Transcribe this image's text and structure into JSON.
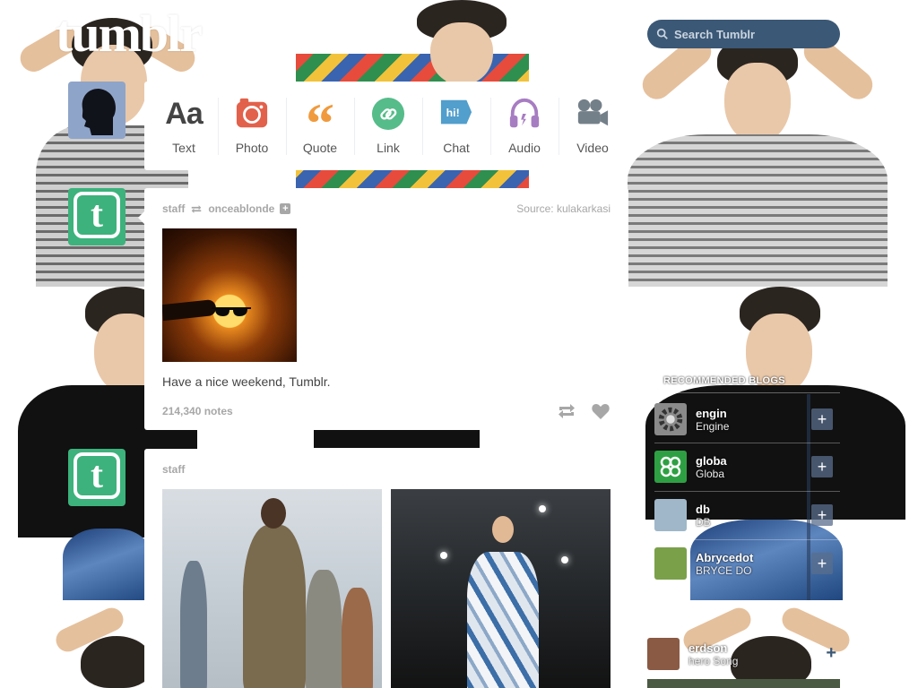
{
  "app": {
    "logo": "tumblr"
  },
  "search": {
    "placeholder": "Search Tumblr"
  },
  "post_types": [
    {
      "label": "Text",
      "icon": "text-icon",
      "color": "#444444"
    },
    {
      "label": "Photo",
      "icon": "camera-icon",
      "color": "#e2614b"
    },
    {
      "label": "Quote",
      "icon": "quote-icon",
      "color": "#f09a3e"
    },
    {
      "label": "Link",
      "icon": "link-icon",
      "color": "#56bc8a"
    },
    {
      "label": "Chat",
      "icon": "chat-icon",
      "color": "#529ecc"
    },
    {
      "label": "Audio",
      "icon": "headphones-icon",
      "color": "#a77dc2"
    },
    {
      "label": "Video",
      "icon": "video-camera-icon",
      "color": "#748089"
    }
  ],
  "posts": [
    {
      "author": "staff",
      "reblogged_from": "onceablonde",
      "source": "Source: kulakarkasi",
      "caption": "Have a nice weekend, Tumblr.",
      "notes": "214,340 notes"
    },
    {
      "author": "staff"
    }
  ],
  "sidebar": {
    "recommended_heading": "RECOMMENDED BLOGS",
    "recommended": [
      {
        "name": "engin",
        "subtitle": "Engine",
        "avatar_color": "#8a8a8a"
      },
      {
        "name": "globa",
        "subtitle": "Globa",
        "avatar_color": "#2ea043"
      },
      {
        "name": "db",
        "subtitle": "DB",
        "avatar_color": "#9fb7c9"
      },
      {
        "name": "Abrycedot",
        "subtitle": "BRYCE DO",
        "avatar_color": "#7aa04a"
      }
    ],
    "radar": {
      "name": "erdson",
      "subtitle": "hero Song",
      "plus": "+"
    }
  },
  "colors": {
    "tumblr_blue": "#36465d",
    "search_bg": "#3b5876",
    "staff_green": "#3db27c"
  }
}
